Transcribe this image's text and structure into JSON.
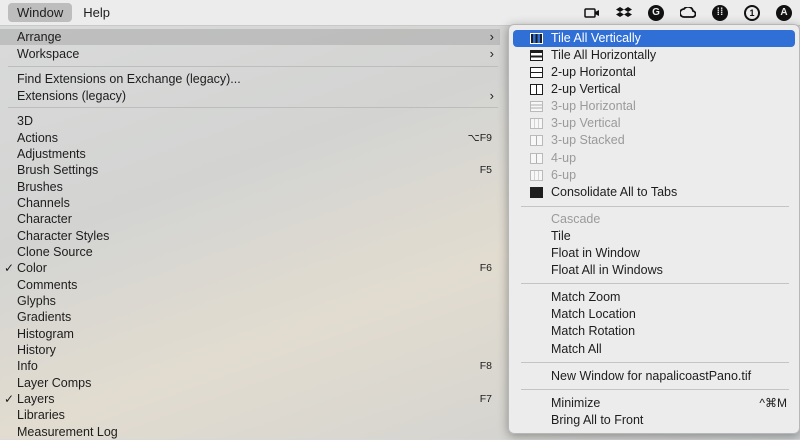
{
  "menubar": {
    "window_label": "Window",
    "help_label": "Help",
    "tray": [
      "camera-icon",
      "dropbox-icon",
      "grammarly-icon",
      "creative-cloud-icon",
      "dots-grid-icon",
      "one-password-icon",
      "a-circle-icon"
    ]
  },
  "window_menu": {
    "items": [
      {
        "label": "Arrange",
        "shortcut": "",
        "submenu": true,
        "check": false
      },
      {
        "label": "Workspace",
        "shortcut": "",
        "submenu": true,
        "check": false
      },
      {
        "label": "Find Extensions on Exchange (legacy)...",
        "shortcut": "",
        "submenu": false,
        "check": false
      },
      {
        "label": "Extensions (legacy)",
        "shortcut": "",
        "submenu": true,
        "check": false
      },
      {
        "label": "3D",
        "shortcut": "",
        "submenu": false,
        "check": false
      },
      {
        "label": "Actions",
        "shortcut": "⌥F9",
        "submenu": false,
        "check": false
      },
      {
        "label": "Adjustments",
        "shortcut": "",
        "submenu": false,
        "check": false
      },
      {
        "label": "Brush Settings",
        "shortcut": "F5",
        "submenu": false,
        "check": false
      },
      {
        "label": "Brushes",
        "shortcut": "",
        "submenu": false,
        "check": false
      },
      {
        "label": "Channels",
        "shortcut": "",
        "submenu": false,
        "check": false
      },
      {
        "label": "Character",
        "shortcut": "",
        "submenu": false,
        "check": false
      },
      {
        "label": "Character Styles",
        "shortcut": "",
        "submenu": false,
        "check": false
      },
      {
        "label": "Clone Source",
        "shortcut": "",
        "submenu": false,
        "check": false
      },
      {
        "label": "Color",
        "shortcut": "F6",
        "submenu": false,
        "check": true
      },
      {
        "label": "Comments",
        "shortcut": "",
        "submenu": false,
        "check": false
      },
      {
        "label": "Glyphs",
        "shortcut": "",
        "submenu": false,
        "check": false
      },
      {
        "label": "Gradients",
        "shortcut": "",
        "submenu": false,
        "check": false
      },
      {
        "label": "Histogram",
        "shortcut": "",
        "submenu": false,
        "check": false
      },
      {
        "label": "History",
        "shortcut": "",
        "submenu": false,
        "check": false
      },
      {
        "label": "Info",
        "shortcut": "F8",
        "submenu": false,
        "check": false
      },
      {
        "label": "Layer Comps",
        "shortcut": "",
        "submenu": false,
        "check": false
      },
      {
        "label": "Layers",
        "shortcut": "F7",
        "submenu": false,
        "check": true
      },
      {
        "label": "Libraries",
        "shortcut": "",
        "submenu": false,
        "check": false
      },
      {
        "label": "Measurement Log",
        "shortcut": "",
        "submenu": false,
        "check": false
      }
    ]
  },
  "arrange_submenu": {
    "items": [
      {
        "label": "Tile All Vertically",
        "icon": "tile-vertical-icon",
        "enabled": true,
        "selected": true
      },
      {
        "label": "Tile All Horizontally",
        "icon": "tile-horizontal-icon",
        "enabled": true
      },
      {
        "label": "2-up Horizontal",
        "icon": "two-up-horizontal-icon",
        "enabled": true
      },
      {
        "label": "2-up Vertical",
        "icon": "two-up-vertical-icon",
        "enabled": true
      },
      {
        "label": "3-up Horizontal",
        "icon": "three-up-horizontal-icon",
        "enabled": false
      },
      {
        "label": "3-up Vertical",
        "icon": "three-up-vertical-icon",
        "enabled": false
      },
      {
        "label": "3-up Stacked",
        "icon": "three-up-stacked-icon",
        "enabled": false
      },
      {
        "label": "4-up",
        "icon": "four-up-icon",
        "enabled": false
      },
      {
        "label": "6-up",
        "icon": "six-up-icon",
        "enabled": false
      },
      {
        "label": "Consolidate All to Tabs",
        "icon": "consolidate-tabs-icon",
        "enabled": true
      },
      {
        "label": "Cascade",
        "enabled": false
      },
      {
        "label": "Tile",
        "enabled": true
      },
      {
        "label": "Float in Window",
        "enabled": true
      },
      {
        "label": "Float All in Windows",
        "enabled": true
      },
      {
        "label": "Match Zoom",
        "enabled": true
      },
      {
        "label": "Match Location",
        "enabled": true
      },
      {
        "label": "Match Rotation",
        "enabled": true
      },
      {
        "label": "Match All",
        "enabled": true
      },
      {
        "label": "New Window for napalicoastPano.tif",
        "enabled": true
      },
      {
        "label": "Minimize",
        "shortcut": "^⌘M",
        "enabled": true
      },
      {
        "label": "Bring All to Front",
        "enabled": true
      }
    ]
  }
}
